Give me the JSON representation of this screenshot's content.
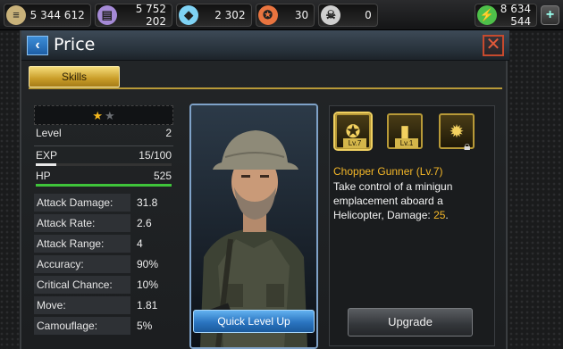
{
  "resources": [
    {
      "icon": "gold-bars-icon",
      "value": "5 344 612",
      "color": "#c9b27a"
    },
    {
      "icon": "oil-barrel-icon",
      "value": "5 752 202",
      "color": "#a58ad6"
    },
    {
      "icon": "diamond-icon",
      "value": "2 302",
      "color": "#7fd3f5"
    },
    {
      "icon": "medal-icon",
      "value": "30",
      "color": "#e9743f"
    },
    {
      "icon": "skull-token-icon",
      "value": "0",
      "color": "#cfcfcf"
    },
    {
      "icon": "green-energy-icon",
      "value": "8 634 544",
      "color": "#4ec04a"
    }
  ],
  "header": {
    "title": "Price",
    "back_label": "‹",
    "close_label": "✕"
  },
  "tabs": {
    "skills": "Skills"
  },
  "stats": {
    "stars_filled": 1,
    "stars_total": 2,
    "level_label": "Level",
    "level_value": "2",
    "exp_label": "EXP",
    "exp_value": "15/100",
    "exp_fraction": 0.15,
    "hp_label": "HP",
    "hp_value": "525",
    "rows": [
      {
        "label": "Attack Damage:",
        "value": "31.8"
      },
      {
        "label": "Attack Rate:",
        "value": "2.6"
      },
      {
        "label": "Attack Range:",
        "value": "4"
      },
      {
        "label": "Accuracy:",
        "value": "90%"
      },
      {
        "label": "Critical Chance:",
        "value": "10%"
      },
      {
        "label": "Move:",
        "value": "1.81"
      },
      {
        "label": "Camouflage:",
        "value": "5%"
      }
    ]
  },
  "portrait": {
    "quick_level_label": "Quick Level Up"
  },
  "skills": {
    "icons": [
      {
        "icon": "chopper-gunner-icon",
        "level": "Lv.7",
        "selected": true,
        "locked": false
      },
      {
        "icon": "bullet-icon",
        "level": "Lv.1",
        "selected": false,
        "locked": false
      },
      {
        "icon": "sun-emblem-icon",
        "level": "",
        "selected": false,
        "locked": true
      }
    ],
    "name": "Chopper Gunner (Lv.7)",
    "desc_prefix": "Take control of a minigun emplacement aboard a Helicopter, Damage: ",
    "damage": "25",
    "desc_suffix": ".",
    "upgrade_label": "Upgrade"
  },
  "colors": {
    "accent_gold": "#f3b628",
    "hp_green": "#3fc43a",
    "exp_white": "#e8e8e8"
  }
}
